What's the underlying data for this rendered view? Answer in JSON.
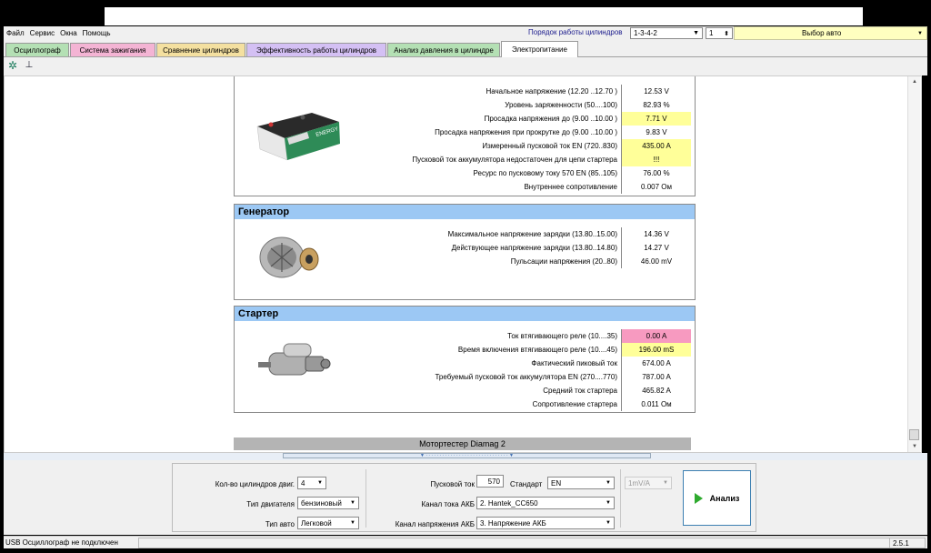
{
  "menu": [
    "Файл",
    "Сервис",
    "Окна",
    "Помощь"
  ],
  "cylinder_order": {
    "label": "Порядок работы цилиндров",
    "value": "1-3-4-2",
    "spin": "1"
  },
  "car_select": {
    "value": "Выбор авто"
  },
  "tabs": [
    {
      "label": "Осциллограф",
      "color": "#b4e0b4"
    },
    {
      "label": "Система зажигания",
      "color": "#f4b4d4"
    },
    {
      "label": "Сравнение цилиндров",
      "color": "#f4e0a0"
    },
    {
      "label": "Эффективность работы цилиндров",
      "color": "#d4c0f4"
    },
    {
      "label": "Анализ давления в цилиндре",
      "color": "#b4e0b4"
    },
    {
      "label": "Электропитание",
      "color": "#ffffff"
    }
  ],
  "battery": {
    "rows": [
      {
        "label": "Начальное напряжение (12.20 ..12.70 )",
        "value": "12.53 V",
        "hl": ""
      },
      {
        "label": "Уровень заряженности (50....100)",
        "value": "82.93 %",
        "hl": ""
      },
      {
        "label": "Просадка напряжения до (9.00 ..10.00 )",
        "value": "7.71 V",
        "hl": "yel"
      },
      {
        "label": "Просадка напряжения при прокрутке до (9.00 ..10.00 )",
        "value": "9.83 V",
        "hl": ""
      },
      {
        "label": "Измеренный пусковой ток  EN (720..830)",
        "value": "435.00 A",
        "hl": "yel"
      },
      {
        "label": "Пусковой ток аккумулятора недостаточен для цепи стартера",
        "value": "!!!",
        "hl": "yel"
      },
      {
        "label": "Ресурс по пусковому току  570 EN (85..105)",
        "value": "76.00 %",
        "hl": ""
      },
      {
        "label": "Внутреннее сопротивление",
        "value": "0.007 Ом",
        "hl": ""
      }
    ]
  },
  "generator": {
    "title": "Генератор",
    "rows": [
      {
        "label": "Максимальное напряжение зарядки  (13.80..15.00)",
        "value": "14.36 V",
        "hl": ""
      },
      {
        "label": "Действующее напряжение зарядки (13.80..14.80)",
        "value": "14.27 V",
        "hl": ""
      },
      {
        "label": "Пульсации напряжения (20..80)",
        "value": "46.00 mV",
        "hl": ""
      }
    ]
  },
  "starter": {
    "title": "Стартер",
    "rows": [
      {
        "label": "Ток втягивающего реле (10....35)",
        "value": "0.00 A",
        "hl": "pink"
      },
      {
        "label": "Время включения втягивающего реле (10....45)",
        "value": "196.00 mS",
        "hl": "yel"
      },
      {
        "label": "Фактический пиковый ток",
        "value": "674.00 A",
        "hl": ""
      },
      {
        "label": "Требуемый пусковой ток аккумулятора  EN (270....770)",
        "value": "787.00 A",
        "hl": ""
      },
      {
        "label": "Средний ток стартера",
        "value": "465.82 A",
        "hl": ""
      },
      {
        "label": "Сопротивление стартера",
        "value": "0.011 Ом",
        "hl": ""
      }
    ]
  },
  "report_footer": "Мотортестер Diamag 2",
  "settings": {
    "cylinders_label": "Кол-во цилиндров двиг.",
    "cylinders_value": "4",
    "engine_type_label": "Тип двигателя",
    "engine_type_value": "бензиновый",
    "car_type_label": "Тип авто",
    "car_type_value": "Легковой",
    "start_current_label": "Пусковой ток",
    "start_current_value": "570",
    "standard_label": "Стандарт",
    "standard_value": "EN",
    "scale_value": "1mV/A",
    "current_channel_label": "Канал тока АКБ",
    "current_channel_value": "2. Hantek_CC650",
    "voltage_channel_label": "Канал напряжения АКБ",
    "voltage_channel_value": "3. Напряжение АКБ",
    "analyze_label": "Анализ"
  },
  "status": {
    "text": "USB Осциллограф не подключен",
    "version": "2.5.1"
  }
}
